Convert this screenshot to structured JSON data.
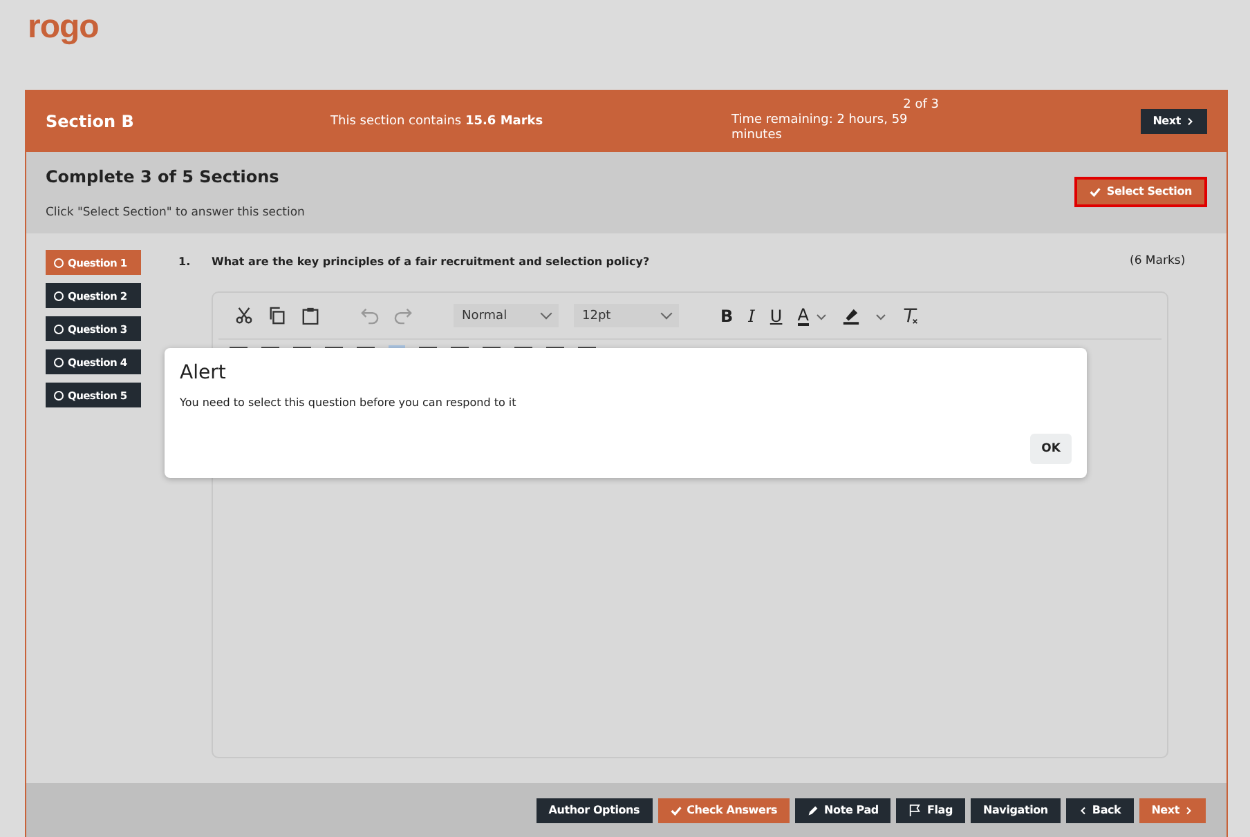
{
  "logo": {
    "text": "rogo"
  },
  "header": {
    "section": "Section B",
    "marks": "This section contains **15.6 Marks**",
    "progress": "2 of 3",
    "time": "Time remaining: 2 hours, 59 minutes",
    "next": "Next"
  },
  "subheader": {
    "title": "Complete 3 of 5 Sections",
    "hint": "Click \"Select Section\" to answer this section",
    "select_button": {
      "label": "Select Section",
      "highlighted": true
    }
  },
  "questions": [
    {
      "label": "Question 1",
      "selected": true
    },
    {
      "label": "Question 2",
      "selected": false
    },
    {
      "label": "Question 3",
      "selected": false
    },
    {
      "label": "Question 4",
      "selected": false
    },
    {
      "label": "Question 5",
      "selected": false
    }
  ],
  "question": {
    "number": "1.",
    "text": "What are the key principles of a fair recruitment and selection policy?",
    "marks": "(6 Marks)"
  },
  "editor": {
    "style": "Normal",
    "size": "12pt",
    "bold": "B",
    "italic": "I",
    "underline": "U",
    "font_color": "A"
  },
  "alert": {
    "title": "Alert",
    "message": "You need to select this question before you can respond to it",
    "ok": "OK"
  },
  "footer": {
    "author_options": "Author Options",
    "check_answers": "Check Answers",
    "note_pad": "Note Pad",
    "flag": "Flag",
    "navigation": "Navigation",
    "back": "Back",
    "next": "Next"
  }
}
